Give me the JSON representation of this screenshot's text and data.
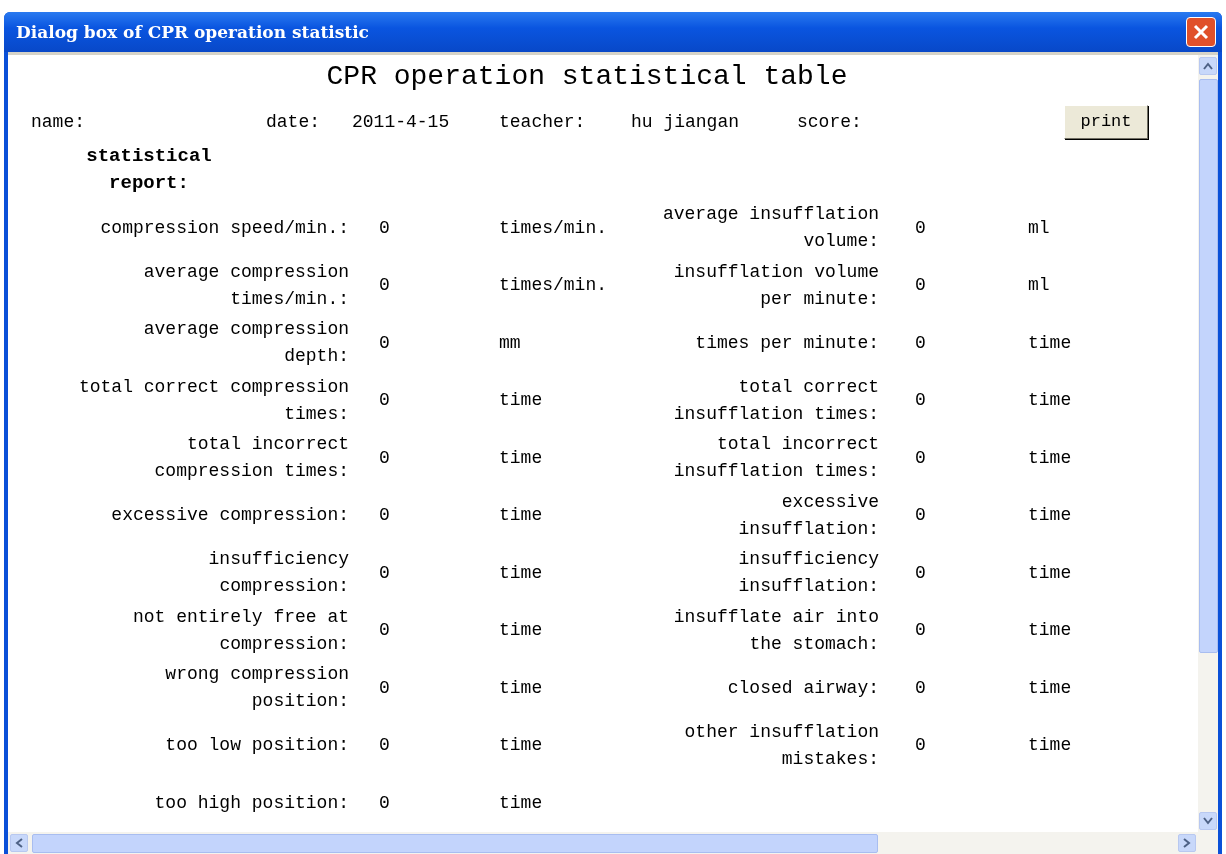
{
  "window": {
    "title": "Dialog box of CPR operation statistic"
  },
  "heading": "CPR operation statistical table",
  "info": [
    {
      "label": "name:"
    },
    {
      "label": "date:",
      "value": "2011-4-15"
    },
    {
      "label": "teacher:",
      "value": "hu jiangan"
    },
    {
      "label": "score:"
    }
  ],
  "print_button": "print",
  "section_title": "statistical\nreport:",
  "rows": [
    {
      "left": {
        "label": "compression speed/min.:",
        "value": "0",
        "unit": "times/min."
      },
      "right": {
        "label": "average insufflation\nvolume:",
        "value": "0",
        "unit": "ml"
      }
    },
    {
      "left": {
        "label": "average compression\ntimes/min.:",
        "value": "0",
        "unit": "times/min."
      },
      "right": {
        "label": "insufflation volume\nper minute:",
        "value": "0",
        "unit": "ml"
      }
    },
    {
      "left": {
        "label": "average compression\ndepth:",
        "value": "0",
        "unit": "mm"
      },
      "right": {
        "label": "times per minute:",
        "value": "0",
        "unit": "time"
      }
    },
    {
      "left": {
        "label": "total correct compression\ntimes:",
        "value": "0",
        "unit": "time"
      },
      "right": {
        "label": "total correct\ninsufflation times:",
        "value": "0",
        "unit": "time"
      }
    },
    {
      "left": {
        "label": "total incorrect\ncompression times:",
        "value": "0",
        "unit": "time"
      },
      "right": {
        "label": "total incorrect\ninsufflation times:",
        "value": "0",
        "unit": "time"
      }
    },
    {
      "left": {
        "label": "excessive compression:",
        "value": "0",
        "unit": "time"
      },
      "right": {
        "label": "excessive\ninsufflation:",
        "value": "0",
        "unit": "time"
      }
    },
    {
      "left": {
        "label": "insufficiency\ncompression:",
        "value": "0",
        "unit": "time"
      },
      "right": {
        "label": "insufficiency\ninsufflation:",
        "value": "0",
        "unit": "time"
      }
    },
    {
      "left": {
        "label": "not entirely free at\ncompression:",
        "value": "0",
        "unit": "time"
      },
      "right": {
        "label": "insufflate air into\nthe stomach:",
        "value": "0",
        "unit": "time"
      }
    },
    {
      "left": {
        "label": "wrong compression\nposition:",
        "value": "0",
        "unit": "time"
      },
      "right": {
        "label": "closed airway:",
        "value": "0",
        "unit": "time"
      }
    },
    {
      "left": {
        "label": "too low position:",
        "value": "0",
        "unit": "time"
      },
      "right": {
        "label": "other insufflation\nmistakes:",
        "value": "0",
        "unit": "time"
      }
    },
    {
      "left": {
        "label": "too high position:",
        "value": "0",
        "unit": "time"
      }
    }
  ]
}
